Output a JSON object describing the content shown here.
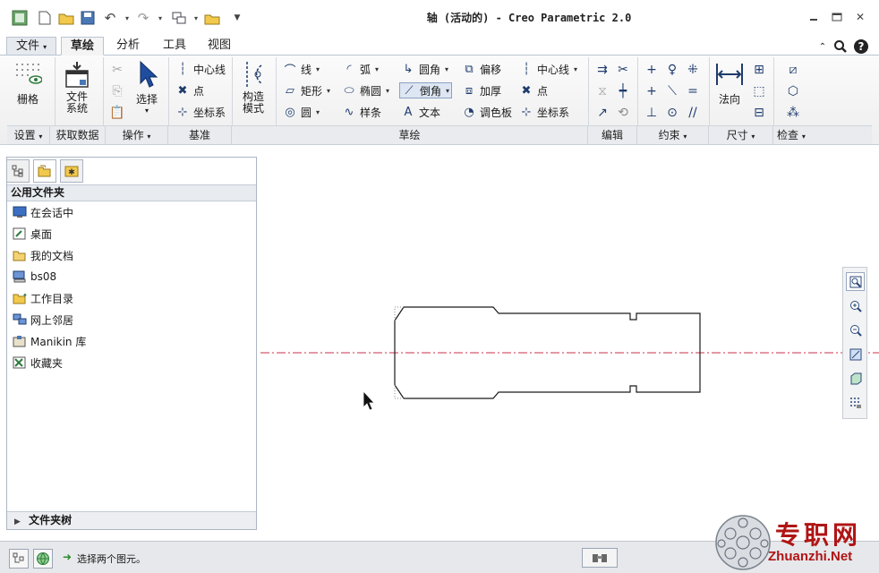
{
  "window": {
    "title": "轴 (活动的) - Creo Parametric 2.0"
  },
  "menu_tabs": [
    "文件",
    "草绘",
    "分析",
    "工具",
    "视图"
  ],
  "active_tab": "草绘",
  "ribbon": {
    "grid_label": "栅格",
    "file_system_label": "文件\n系统",
    "select_label": "选择",
    "construction_mode_label": "构造\n模式",
    "normal_label": "法向",
    "datum_items": [
      "中心线",
      "点",
      "坐标系"
    ],
    "sketch_col1": [
      "线",
      "矩形",
      "圆"
    ],
    "sketch_col2": [
      "弧",
      "椭圆",
      "样条"
    ],
    "sketch_col3": [
      "圆角",
      "倒角",
      "文本"
    ],
    "sketch_col4": [
      "偏移",
      "加厚",
      "调色板"
    ],
    "sketch_col5": [
      "中心线",
      "点",
      "坐标系"
    ],
    "groups": [
      "设置",
      "获取数据",
      "操作",
      "基准",
      "草绘",
      "编辑",
      "约束",
      "尺寸",
      "检查"
    ]
  },
  "folder_panel": {
    "header": "公用文件夹",
    "items": [
      {
        "label": "在会话中",
        "icon": "monitor-icon"
      },
      {
        "label": "桌面",
        "icon": "desktop-icon"
      },
      {
        "label": "我的文档",
        "icon": "folder-open-icon"
      },
      {
        "label": "bs08",
        "icon": "computer-icon"
      },
      {
        "label": "工作目录",
        "icon": "working-folder-icon"
      },
      {
        "label": "网上邻居",
        "icon": "network-icon"
      },
      {
        "label": "Manikin 库",
        "icon": "library-icon"
      },
      {
        "label": "收藏夹",
        "icon": "favorites-icon"
      }
    ],
    "folder_tree_label": "文件夹树"
  },
  "status": {
    "message": "选择两个图元。"
  },
  "watermark": {
    "cn": "专职网",
    "en": "Zhuanzhi.Net"
  },
  "colors": {
    "centerline": "#c8324a",
    "sketch": "#1a1a1a",
    "watermark": "#b01515"
  }
}
